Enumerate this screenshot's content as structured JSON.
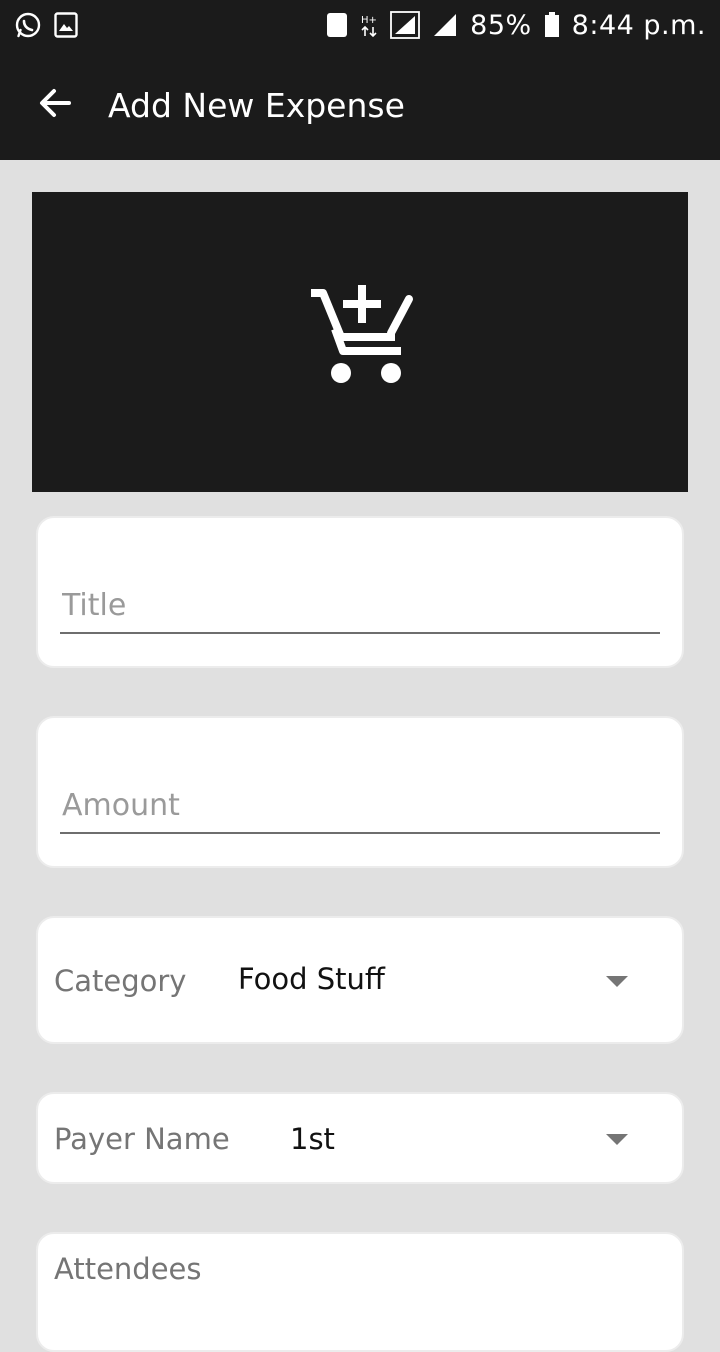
{
  "status_bar": {
    "left_icons": [
      "whatsapp-icon",
      "gallery-icon"
    ],
    "sim_badge": "1",
    "network_label": "H+",
    "battery": "85%",
    "time": "8:44 p.m."
  },
  "toolbar": {
    "title": "Add New Expense"
  },
  "hero": {
    "icon": "add-shopping-cart-icon"
  },
  "form": {
    "title": {
      "placeholder": "Title",
      "value": ""
    },
    "amount": {
      "placeholder": "Amount",
      "value": ""
    },
    "category": {
      "label": "Category",
      "value": "Food Stuff"
    },
    "payer": {
      "label": "Payer Name",
      "value": "1st"
    },
    "attendees": {
      "label": "Attendees"
    }
  },
  "colors": {
    "bar_background": "#1b1b1b",
    "page_background": "#e0e0e0",
    "card_background": "#ffffff"
  }
}
